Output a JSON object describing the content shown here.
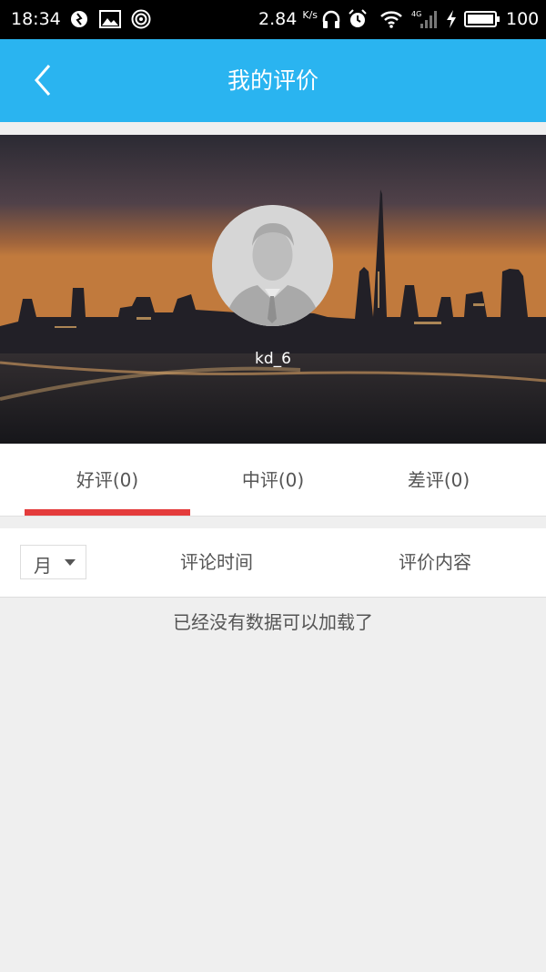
{
  "status_bar": {
    "time": "18:34",
    "net_speed": "2.84",
    "net_speed_unit": "K/s",
    "battery_percent": "100",
    "icons": [
      "sync-icon",
      "image-icon",
      "radar-icon",
      "headset-icon",
      "alarm-icon",
      "wifi-icon",
      "signal-4g-icon",
      "charging-icon",
      "battery-icon"
    ]
  },
  "header": {
    "title": "我的评价",
    "back_icon": "back-chevron-icon",
    "background_color": "#2ab4f0"
  },
  "profile": {
    "username": "kd_6",
    "avatar_icon": "default-avatar-icon"
  },
  "tabs": [
    {
      "label": "好评(0)",
      "active": true
    },
    {
      "label": "中评(0)",
      "active": false
    },
    {
      "label": "差评(0)",
      "active": false
    }
  ],
  "accent_color": "#e43c3c",
  "table_header": {
    "month_selector": "月",
    "col_time": "评论时间",
    "col_content": "评价内容"
  },
  "empty_message": "已经没有数据可以加载了"
}
